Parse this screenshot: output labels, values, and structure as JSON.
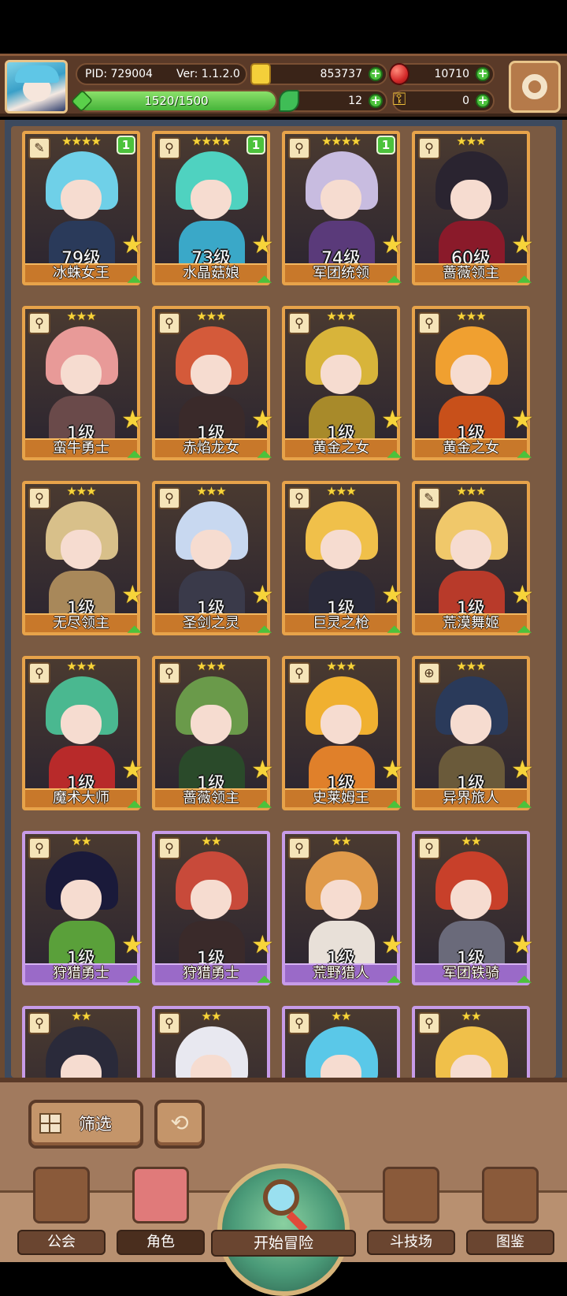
{
  "header": {
    "pid": "PID: 729004",
    "version": "Ver: 1.1.2.0",
    "coins": "853737",
    "gems": "10710",
    "exp_text": "1520/1500",
    "exp_fraction": 1.0,
    "clovers": "12",
    "keys": "0"
  },
  "cards": [
    {
      "name": "冰蛛女王",
      "level": "79级",
      "stars": "★★★★",
      "badge": "1",
      "frame": "gold",
      "weapon": "✎",
      "hair": "#6fd0e8",
      "body": "#2a3a5a"
    },
    {
      "name": "水晶菇娘",
      "level": "73级",
      "stars": "★★★★",
      "badge": "1",
      "frame": "gold",
      "weapon": "⚲",
      "hair": "#4fd2c0",
      "body": "#3aa8c8"
    },
    {
      "name": "军团统领",
      "level": "74级",
      "stars": "★★★★",
      "badge": "1",
      "frame": "gold",
      "weapon": "⚲",
      "hair": "#c8bce0",
      "body": "#5a3a7a"
    },
    {
      "name": "蔷薇领主",
      "level": "60级",
      "stars": "★★★",
      "badge": "",
      "frame": "gold",
      "weapon": "⚲",
      "hair": "#2a2430",
      "body": "#8a1a2a"
    },
    {
      "name": "蛮牛勇士",
      "level": "1级",
      "stars": "★★★",
      "badge": "",
      "frame": "gold",
      "weapon": "⚲",
      "hair": "#e89a98",
      "body": "#6a4a4a"
    },
    {
      "name": "赤焰龙女",
      "level": "1级",
      "stars": "★★★",
      "badge": "",
      "frame": "gold",
      "weapon": "⚲",
      "hair": "#d45a3a",
      "body": "#3a2a2a"
    },
    {
      "name": "黄金之女",
      "level": "1级",
      "stars": "★★★",
      "badge": "",
      "frame": "gold",
      "weapon": "⚲",
      "hair": "#d8b43a",
      "body": "#a88a2a"
    },
    {
      "name": "黄金之女",
      "level": "1级",
      "stars": "★★★",
      "badge": "",
      "frame": "gold",
      "weapon": "⚲",
      "hair": "#f0a030",
      "body": "#c8501a"
    },
    {
      "name": "无尽领主",
      "level": "1级",
      "stars": "★★★",
      "badge": "",
      "frame": "gold",
      "weapon": "⚲",
      "hair": "#d8c08a",
      "body": "#a8885a"
    },
    {
      "name": "圣剑之灵",
      "level": "1级",
      "stars": "★★★",
      "badge": "",
      "frame": "gold",
      "weapon": "⚲",
      "hair": "#c8d8f0",
      "body": "#3a3a4a"
    },
    {
      "name": "巨灵之枪",
      "level": "1级",
      "stars": "★★★",
      "badge": "",
      "frame": "gold",
      "weapon": "⚲",
      "hair": "#f0c04a",
      "body": "#2a2a3a"
    },
    {
      "name": "荒漠舞姬",
      "level": "1级",
      "stars": "★★★",
      "badge": "",
      "frame": "gold",
      "weapon": "✎",
      "hair": "#f0c86a",
      "body": "#b83a2a"
    },
    {
      "name": "魔术大师",
      "level": "1级",
      "stars": "★★★",
      "badge": "",
      "frame": "gold",
      "weapon": "⚲",
      "hair": "#4ab890",
      "body": "#b82a2a"
    },
    {
      "name": "蔷薇领主",
      "level": "1级",
      "stars": "★★★",
      "badge": "",
      "frame": "gold",
      "weapon": "⚲",
      "hair": "#6a9a4a",
      "body": "#2a4a2a"
    },
    {
      "name": "史莱姆王",
      "level": "1级",
      "stars": "★★★",
      "badge": "",
      "frame": "gold",
      "weapon": "⚲",
      "hair": "#f0b030",
      "body": "#e0802a"
    },
    {
      "name": "异界旅人",
      "level": "1级",
      "stars": "★★★",
      "badge": "",
      "frame": "gold",
      "weapon": "⊕",
      "hair": "#2a3a5a",
      "body": "#6a5a3a"
    },
    {
      "name": "狩猎勇士",
      "level": "1级",
      "stars": "★★",
      "badge": "",
      "frame": "purple",
      "weapon": "⚲",
      "hair": "#1a1a3a",
      "body": "#5aa03a"
    },
    {
      "name": "狩猎勇士",
      "level": "1级",
      "stars": "★★",
      "badge": "",
      "frame": "purple",
      "weapon": "⚲",
      "hair": "#c84a3a",
      "body": "#3a2a2a"
    },
    {
      "name": "荒野猎人",
      "level": "1级",
      "stars": "★★",
      "badge": "",
      "frame": "purple",
      "weapon": "⚲",
      "hair": "#e09a4a",
      "body": "#e8e0d8"
    },
    {
      "name": "军团铁骑",
      "level": "1级",
      "stars": "★★",
      "badge": "",
      "frame": "purple",
      "weapon": "⚲",
      "hair": "#c8402a",
      "body": "#6a6a7a"
    },
    {
      "name": "",
      "level": "",
      "stars": "★★",
      "badge": "",
      "frame": "purple",
      "weapon": "⚲",
      "hair": "#2a2a3a",
      "body": "#6a5a6a"
    },
    {
      "name": "",
      "level": "",
      "stars": "★★",
      "badge": "",
      "frame": "purple",
      "weapon": "⚲",
      "hair": "#e8e8f0",
      "body": "#8a8aa0"
    },
    {
      "name": "",
      "level": "",
      "stars": "★★",
      "badge": "",
      "frame": "purple",
      "weapon": "⚲",
      "hair": "#5ac8e8",
      "body": "#3a7a9a"
    },
    {
      "name": "",
      "level": "",
      "stars": "★★",
      "badge": "",
      "frame": "purple",
      "weapon": "⚲",
      "hair": "#f0c04a",
      "body": "#c88a3a"
    }
  ],
  "controls": {
    "filter_label": "筛选",
    "refresh_icon": "refresh-icon"
  },
  "nav": {
    "guild": "公会",
    "character": "角色",
    "adventure": "开始冒险",
    "arena": "斗技场",
    "codex": "图鉴"
  },
  "colors": {
    "gold_frame": "#e7a34a",
    "purple_frame": "#c79be8",
    "plus_green": "#4cc23c",
    "panel_brown": "#a17a5e"
  }
}
